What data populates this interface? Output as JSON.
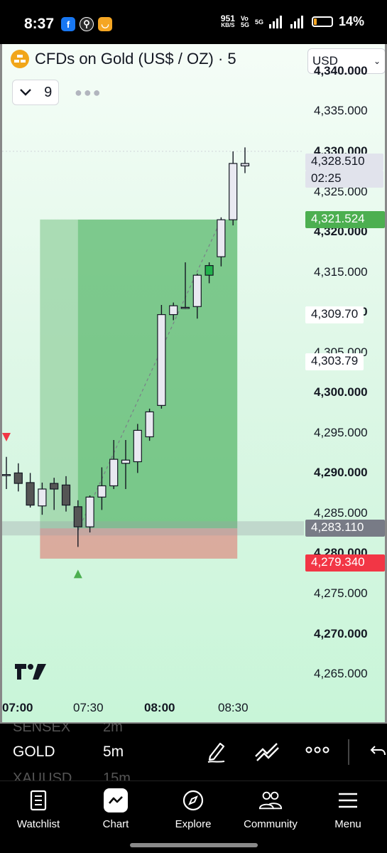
{
  "status_bar": {
    "time": "8:37",
    "speed_value": "951",
    "speed_unit": "KB/S",
    "network": "5G",
    "battery": "14%",
    "app_icons": [
      "facebook-icon",
      "walk-icon",
      "app-icon"
    ]
  },
  "chart_header": {
    "symbol_title": "CFDs on Gold (US$ / OZ) · 5",
    "currency": "USD",
    "indicator_count": "9"
  },
  "price_axis": {
    "labels": [
      {
        "text": "4,340.000",
        "bold": true
      },
      {
        "text": "4,335.000",
        "bold": false
      },
      {
        "text": "4,330.000",
        "bold": true
      },
      {
        "text": "4,325.000",
        "bold": false
      },
      {
        "text": "4,320.000",
        "bold": true
      },
      {
        "text": "4,315.000",
        "bold": false
      },
      {
        "text": "4,310.000",
        "bold": true
      },
      {
        "text": "4,305.000",
        "bold": false
      },
      {
        "text": "4,300.000",
        "bold": true
      },
      {
        "text": "4,295.000",
        "bold": false
      },
      {
        "text": "4,290.000",
        "bold": true
      },
      {
        "text": "4,285.000",
        "bold": false
      },
      {
        "text": "4,280.000",
        "bold": true
      },
      {
        "text": "4,275.000",
        "bold": false
      },
      {
        "text": "4,270.000",
        "bold": true
      },
      {
        "text": "4,265.000",
        "bold": false
      }
    ],
    "tags": {
      "current_price": "4,328.510",
      "countdown": "02:25",
      "take_profit": "4,321.524",
      "level_a": "4,309.70",
      "level_b": "4,303.79",
      "entry": "4,283.110",
      "stop_loss": "4,279.340"
    }
  },
  "time_axis": [
    {
      "text": "07:00",
      "bold": true
    },
    {
      "text": "07:30",
      "bold": false
    },
    {
      "text": "08:00",
      "bold": true
    },
    {
      "text": "08:30",
      "bold": false
    }
  ],
  "chart_data": {
    "type": "candlestick",
    "symbol": "CFDs on Gold (US$ / OZ)",
    "interval": "5",
    "ylim": [
      4262,
      4343
    ],
    "candles": [
      {
        "o": 4289.8,
        "h": 4292.0,
        "l": 4288.0,
        "c": 4289.8
      },
      {
        "o": 4290.0,
        "h": 4291.2,
        "l": 4287.7,
        "c": 4288.7
      },
      {
        "o": 4288.8,
        "h": 4290.0,
        "l": 4285.7,
        "c": 4286.0
      },
      {
        "o": 4285.9,
        "h": 4288.8,
        "l": 4284.8,
        "c": 4288.0
      },
      {
        "o": 4288.7,
        "h": 4289.4,
        "l": 4285.4,
        "c": 4288.0
      },
      {
        "o": 4288.5,
        "h": 4289.6,
        "l": 4285.2,
        "c": 4286.0
      },
      {
        "o": 4285.8,
        "h": 4286.6,
        "l": 4280.8,
        "c": 4283.3
      },
      {
        "o": 4283.3,
        "h": 4287.2,
        "l": 4282.6,
        "c": 4287.0
      },
      {
        "o": 4287.0,
        "h": 4290.7,
        "l": 4285.4,
        "c": 4288.4
      },
      {
        "o": 4288.4,
        "h": 4294.1,
        "l": 4288.0,
        "c": 4291.7
      },
      {
        "o": 4291.2,
        "h": 4294.1,
        "l": 4288.0,
        "c": 4291.6
      },
      {
        "o": 4291.4,
        "h": 4296.1,
        "l": 4290.0,
        "c": 4295.3
      },
      {
        "o": 4294.5,
        "h": 4298.0,
        "l": 4294.0,
        "c": 4297.6
      },
      {
        "o": 4298.4,
        "h": 4310.9,
        "l": 4298.0,
        "c": 4309.7
      },
      {
        "o": 4309.7,
        "h": 4311.2,
        "l": 4309.0,
        "c": 4310.8
      },
      {
        "o": 4310.5,
        "h": 4316.2,
        "l": 4310.4,
        "c": 4310.6
      },
      {
        "o": 4310.7,
        "h": 4314.8,
        "l": 4309.2,
        "c": 4314.6
      },
      {
        "o": 4314.6,
        "h": 4316.2,
        "l": 4313.6,
        "c": 4315.8
      },
      {
        "o": 4316.9,
        "h": 4321.8,
        "l": 4315.7,
        "c": 4321.5
      },
      {
        "o": 4321.5,
        "h": 4330.0,
        "l": 4320.8,
        "c": 4328.5
      },
      {
        "o": 4328.2,
        "h": 4330.5,
        "l": 4327.3,
        "c": 4328.5
      }
    ]
  },
  "bottom_bar": {
    "ghost_above": [
      "SENSEX",
      "2m"
    ],
    "symbol": "GOLD",
    "timeframe": "5m",
    "ghost_below": [
      "XAUUSD",
      "15m"
    ]
  },
  "tabs": [
    {
      "label": "Watchlist",
      "icon": "watchlist-icon"
    },
    {
      "label": "Chart",
      "icon": "chart-icon",
      "active": true
    },
    {
      "label": "Explore",
      "icon": "compass-icon"
    },
    {
      "label": "Community",
      "icon": "community-icon"
    },
    {
      "label": "Menu",
      "icon": "menu-icon"
    }
  ],
  "colors": {
    "bull": "#e9e9f1",
    "bear": "#555555",
    "highlight_candle": "#22b14c",
    "profit_zone": "#5ab86c",
    "loss_zone": "#e07a72",
    "entry_tag": "#787b86",
    "stop_tag": "#f23645",
    "tp_tag": "#4caf50"
  }
}
